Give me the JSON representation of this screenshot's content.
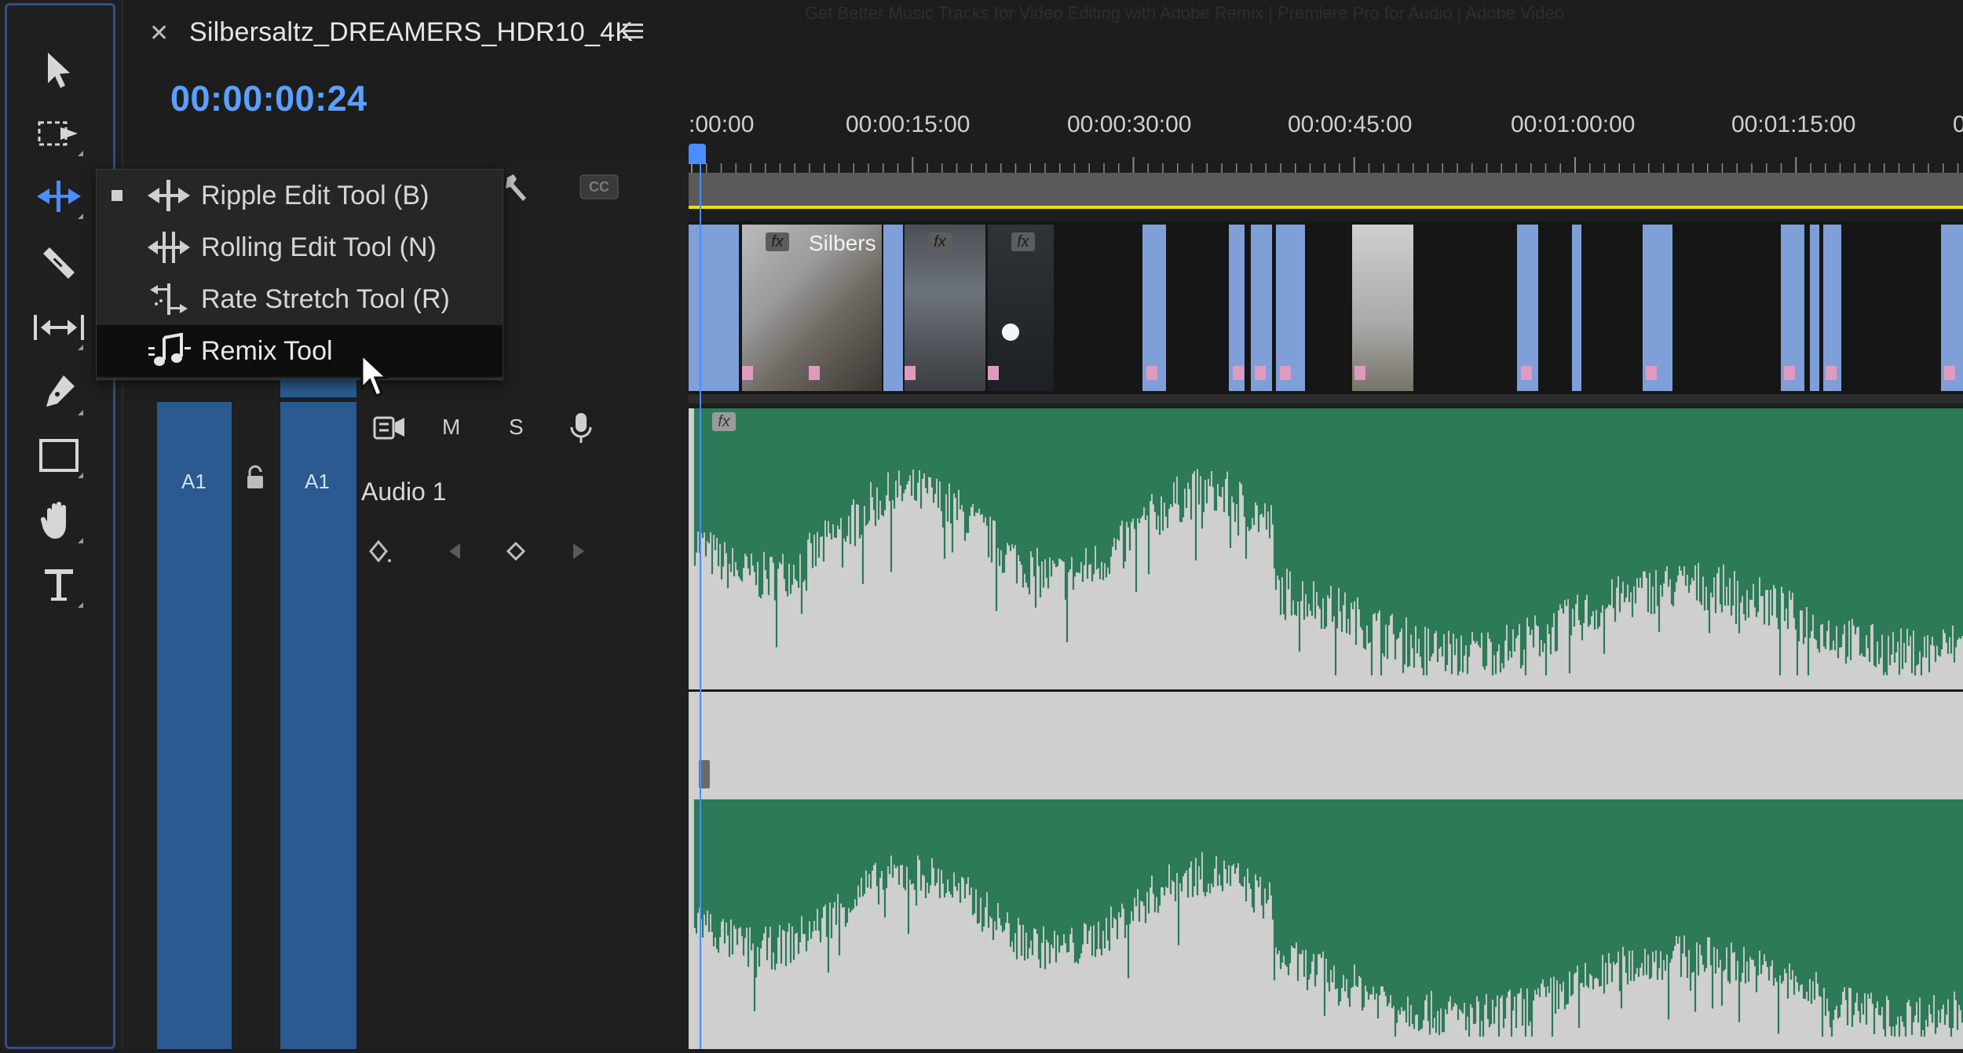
{
  "sequence": {
    "name": "Silbersaltz_DREAMERS_HDR10_4K",
    "timecode": "00:00:00:24",
    "ghost_title": "Get Better Music Tracks for Video Editing with Adobe Remix | Premiere Pro for Audio | Adobe Video"
  },
  "ruler": {
    "ticks": [
      ":00:00",
      "00:00:15:00",
      "00:00:30:00",
      "00:00:45:00",
      "00:01:00:00",
      "00:01:15:00",
      "0"
    ]
  },
  "tools": [
    {
      "icon": "selection-tool-icon"
    },
    {
      "icon": "track-select-tool-icon"
    },
    {
      "icon": "ripple-edit-tool-icon",
      "active": true
    },
    {
      "icon": "razor-tool-icon"
    },
    {
      "icon": "slip-tool-icon"
    },
    {
      "icon": "pen-tool-icon"
    },
    {
      "icon": "rectangle-tool-icon"
    },
    {
      "icon": "hand-tool-icon"
    },
    {
      "icon": "type-tool-icon"
    }
  ],
  "tool_menu": {
    "items": [
      {
        "label": "Ripple Edit Tool (B)",
        "icon": "ripple-edit-icon",
        "checked": true
      },
      {
        "label": "Rolling Edit Tool (N)",
        "icon": "rolling-edit-icon"
      },
      {
        "label": "Rate Stretch Tool (R)",
        "icon": "rate-stretch-icon"
      },
      {
        "label": "Remix Tool",
        "icon": "remix-tool-icon",
        "hovered": true
      }
    ]
  },
  "tracks": {
    "audio": {
      "source_label": "A1",
      "target_label": "A1",
      "name": "Audio 1",
      "mute": "M",
      "solo": "S"
    },
    "video": {
      "clip_label": "Silbers",
      "fx": "fx"
    }
  },
  "colors": {
    "accent": "#4a8dff",
    "timecode": "#5aa0ff",
    "track_target": "#2a5a8f",
    "waveform": "#2c7a57",
    "clip": "#7f9fd8",
    "work_area_line": "#f0e200"
  }
}
